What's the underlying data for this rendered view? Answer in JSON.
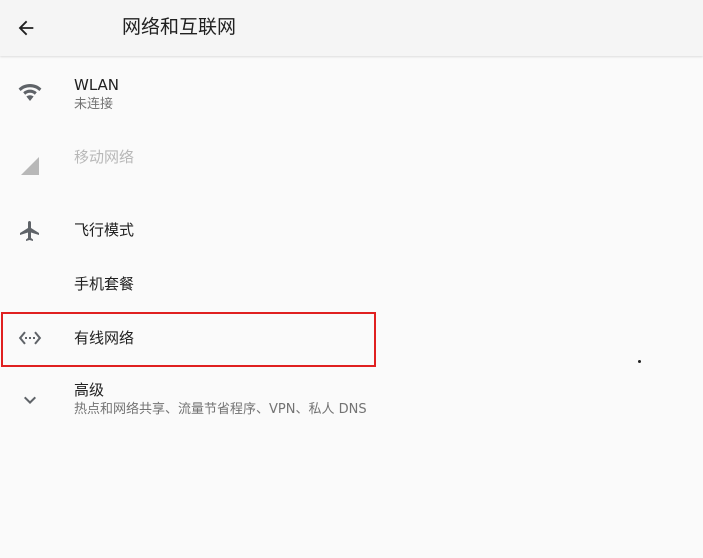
{
  "header": {
    "title": "网络和互联网"
  },
  "items": [
    {
      "id": "wlan",
      "title": "WLAN",
      "summary": "未连接",
      "icon": "wifi-icon",
      "enabled": true
    },
    {
      "id": "mobile",
      "title": "移动网络",
      "icon": "cellular-signal-icon",
      "enabled": false
    },
    {
      "id": "airplane",
      "title": "飞行模式",
      "icon": "airplane-icon",
      "enabled": true
    },
    {
      "id": "plan",
      "title": "手机套餐",
      "enabled": true
    },
    {
      "id": "ethernet",
      "title": "有线网络",
      "icon": "ethernet-icon",
      "enabled": true,
      "highlighted": true
    },
    {
      "id": "advanced",
      "title": "高级",
      "summary": "热点和网络共享、流量节省程序、VPN、私人 DNS",
      "icon": "chevron-down-icon",
      "enabled": true
    }
  ],
  "colors": {
    "highlight_border": "#e02020",
    "icon": "#5f6368",
    "disabled": "#b8b8b8"
  }
}
